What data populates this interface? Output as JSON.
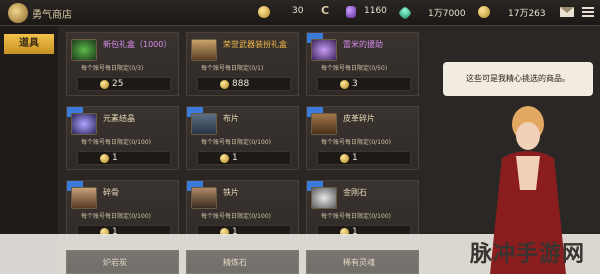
{
  "topbar": {
    "title": "勇气商店",
    "gold1": "30",
    "cera": "1160",
    "gem": "1万7000",
    "gold2": "17万263"
  },
  "sidebar": {
    "tab_label": "道具"
  },
  "items": [
    {
      "name": "新包礼盒（1000）",
      "limit": "每个账号每日限定(0/3)",
      "price": "25"
    },
    {
      "name": "荣誉武器装扮礼盒",
      "limit": "每个账号每日限定(0/1)",
      "price": "888"
    },
    {
      "name": "雷米的援助",
      "limit": "每个账号每日限定(0/50)",
      "price": "3"
    },
    {
      "name": "元素结晶",
      "limit": "每个账号每日限定(0/100)",
      "price": "1"
    },
    {
      "name": "布片",
      "limit": "每个账号每日限定(0/100)",
      "price": "1"
    },
    {
      "name": "皮革碎片",
      "limit": "每个账号每日限定(0/100)",
      "price": "1"
    },
    {
      "name": "碎骨",
      "limit": "每个账号每日限定(0/100)",
      "price": "1"
    },
    {
      "name": "铁片",
      "limit": "每个账号每日限定(0/100)",
      "price": "1"
    },
    {
      "name": "金刚石",
      "limit": "每个账号每日限定(0/100)",
      "price": "1"
    },
    {
      "name": "炉岩炭",
      "limit": "",
      "price": ""
    },
    {
      "name": "精炼石",
      "limit": "",
      "price": ""
    },
    {
      "name": "稀有灵魂",
      "limit": "",
      "price": ""
    }
  ],
  "npc": {
    "speech": "这些可是我精心挑选的商品。"
  },
  "watermark": "脉冲手游网"
}
